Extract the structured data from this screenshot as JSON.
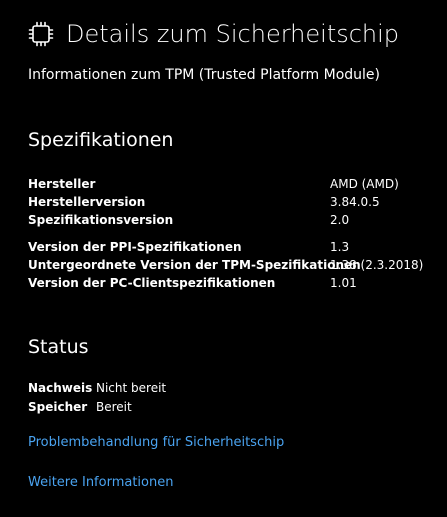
{
  "header": {
    "icon": "chip-icon",
    "title": "Details zum Sicherheitschip"
  },
  "subtitle": "Informationen zum TPM (Trusted Platform Module)",
  "specifications": {
    "heading": "Spezifikationen",
    "group1": [
      {
        "label": "Hersteller",
        "value": "AMD (AMD)"
      },
      {
        "label": "Herstellerversion",
        "value": "3.84.0.5"
      },
      {
        "label": "Spezifikationsversion",
        "value": "2.0"
      }
    ],
    "group2": [
      {
        "label": "Version der PPI-Spezifikationen",
        "value": "1.3"
      },
      {
        "label": "Untergeordnete Version der TPM-Spezifikationen",
        "value": "1.38 (2.3.2018)"
      },
      {
        "label": "Version der PC-Clientspezifikationen",
        "value": "1.01"
      }
    ]
  },
  "status": {
    "heading": "Status",
    "rows": [
      {
        "label": "Nachweis",
        "value": "Nicht bereit"
      },
      {
        "label": "Speicher",
        "value": "Bereit"
      }
    ]
  },
  "links": {
    "troubleshoot": "Problembehandlung für Sicherheitschip",
    "more_info": "Weitere Informationen"
  },
  "colors": {
    "background": "#000000",
    "text": "#ffffff",
    "link": "#4aa3f0"
  }
}
